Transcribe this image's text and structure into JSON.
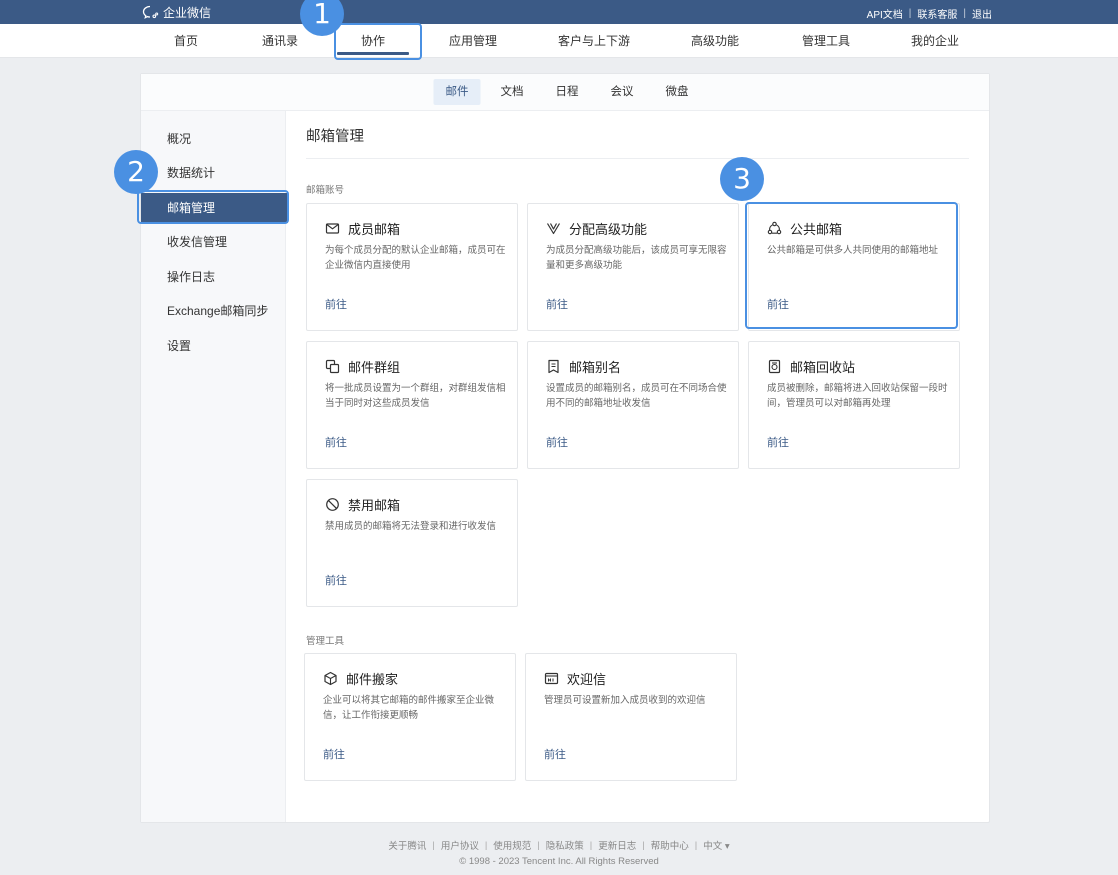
{
  "topbar": {
    "logo_text": "企业微信",
    "links": [
      "API文档",
      "联系客服",
      "退出"
    ]
  },
  "nav": {
    "items": [
      "首页",
      "通讯录",
      "协作",
      "应用管理",
      "客户与上下游",
      "高级功能",
      "管理工具",
      "我的企业"
    ],
    "active": "协作"
  },
  "badges": [
    "1",
    "2",
    "3"
  ],
  "subnav": {
    "items": [
      "邮件",
      "文档",
      "日程",
      "会议",
      "微盘"
    ],
    "active": "邮件"
  },
  "sidebar": {
    "items": [
      "概况",
      "数据统计",
      "邮箱管理",
      "收发信管理",
      "操作日志",
      "Exchange邮箱同步",
      "设置"
    ],
    "active": "邮箱管理"
  },
  "page_title": "邮箱管理",
  "sections": {
    "account_label": "邮箱账号",
    "tools_label": "管理工具"
  },
  "cards": [
    {
      "icon": "mail-icon",
      "title": "成员邮箱",
      "desc": "为每个成员分配的默认企业邮箱，成员可在企业微信内直接使用",
      "link": "前往"
    },
    {
      "icon": "v-icon",
      "title": "分配高级功能",
      "desc": "为成员分配高级功能后，该成员可享无限容量和更多高级功能",
      "link": "前往"
    },
    {
      "icon": "share-icon",
      "title": "公共邮箱",
      "desc": "公共邮箱是可供多人共同使用的邮箱地址",
      "link": "前往"
    },
    {
      "icon": "group-icon",
      "title": "邮件群组",
      "desc": "将一批成员设置为一个群组，对群组发信相当于同时对这些成员发信",
      "link": "前往"
    },
    {
      "icon": "alias-icon",
      "title": "邮箱别名",
      "desc": "设置成员的邮箱别名，成员可在不同场合使用不同的邮箱地址收发信",
      "link": "前往"
    },
    {
      "icon": "recycle-icon",
      "title": "邮箱回收站",
      "desc": "成员被删除，邮箱将进入回收站保留一段时间，管理员可以对邮箱再处理",
      "link": "前往"
    },
    {
      "icon": "ban-icon",
      "title": "禁用邮箱",
      "desc": "禁用成员的邮箱将无法登录和进行收发信",
      "link": "前往"
    }
  ],
  "tool_cards": [
    {
      "icon": "box-icon",
      "title": "邮件搬家",
      "desc": "企业可以将其它邮箱的邮件搬家至企业微信，让工作衔接更顺畅",
      "link": "前往"
    },
    {
      "icon": "welcome-icon",
      "title": "欢迎信",
      "desc": "管理员可设置新加入成员收到的欢迎信",
      "link": "前往"
    }
  ],
  "footer": {
    "links": [
      "关于腾讯",
      "用户协议",
      "使用规范",
      "隐私政策",
      "更新日志",
      "帮助中心",
      "中文 ▾"
    ],
    "copyright": "© 1998 - 2023 Tencent Inc. All Rights Reserved"
  }
}
